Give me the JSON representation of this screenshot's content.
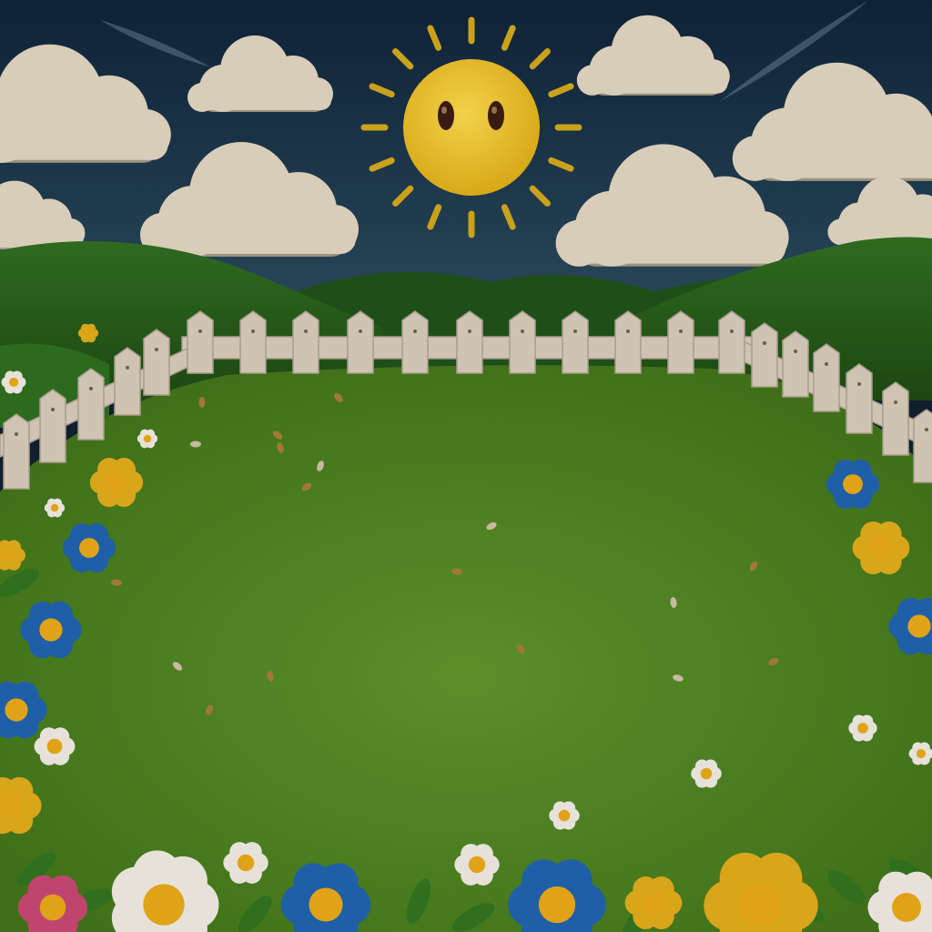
{
  "scene": {
    "kind": "cartoon-meadow-game-background",
    "dimmed": true,
    "elements": [
      "sky",
      "sun-with-face",
      "clouds",
      "rolling-hills",
      "picket-fence",
      "grass-field",
      "flowers"
    ]
  },
  "colors": {
    "sky_top": "#0e2236",
    "sky_bottom": "#2f4f62",
    "cloud": "#d8cdb8",
    "cloud_shadow": "#9c927f",
    "sun": "#e2b81c",
    "sun_core": "#f2d24a",
    "sun_ray": "#c9a21a",
    "eye": "#3a1b12",
    "hill_far": "#1f4f19",
    "hill_near": "#2f6a1f",
    "field": "#4b7f22",
    "field_center": "#5a8f2a",
    "fence": "#cfc3b2",
    "fence_shade": "#a89c8c",
    "flower_blue": "#1f5fa8",
    "flower_yellow": "#d9a51a",
    "flower_white": "#e6e2da",
    "flower_pink": "#c0456e",
    "flower_center": "#e0a317",
    "leaf": "#2f6f1e"
  },
  "icons": {
    "sun": "sun-icon",
    "cloud": "cloud-icon",
    "flower": "flower-icon",
    "fence_post": "fence-post-icon"
  }
}
